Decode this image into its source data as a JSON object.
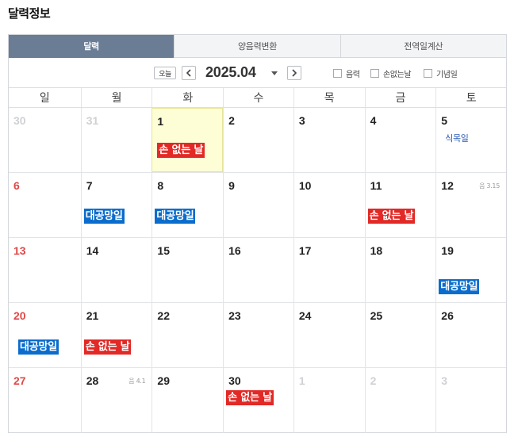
{
  "page": {
    "title": "달력정보"
  },
  "tabs": [
    {
      "label": "달력",
      "active": true
    },
    {
      "label": "양음력변환",
      "active": false
    },
    {
      "label": "전역일계산",
      "active": false
    }
  ],
  "controls": {
    "today_label": "오늘",
    "month_label": "2025.04",
    "options": [
      {
        "label": "음력",
        "checked": false
      },
      {
        "label": "손없는날",
        "checked": false
      },
      {
        "label": "기념일",
        "checked": false
      }
    ]
  },
  "weekdays": [
    "일",
    "월",
    "화",
    "수",
    "목",
    "금",
    "토"
  ],
  "weeks": [
    [
      {
        "day": "30",
        "other": true
      },
      {
        "day": "31",
        "other": true
      },
      {
        "day": "1",
        "today": true,
        "badge": {
          "text": "손 없는 날",
          "color": "red"
        }
      },
      {
        "day": "2"
      },
      {
        "day": "3"
      },
      {
        "day": "4"
      },
      {
        "day": "5",
        "holiday": "식목일"
      }
    ],
    [
      {
        "day": "6",
        "sunday": true
      },
      {
        "day": "7",
        "badge": {
          "text": "대공망일",
          "color": "blue"
        }
      },
      {
        "day": "8",
        "badge": {
          "text": "대공망일",
          "color": "blue"
        }
      },
      {
        "day": "9"
      },
      {
        "day": "10"
      },
      {
        "day": "11",
        "badge": {
          "text": "손 없는 날",
          "color": "red"
        }
      },
      {
        "day": "12",
        "lunar": "음 3.15"
      }
    ],
    [
      {
        "day": "13",
        "sunday": true
      },
      {
        "day": "14"
      },
      {
        "day": "15"
      },
      {
        "day": "16"
      },
      {
        "day": "17"
      },
      {
        "day": "18"
      },
      {
        "day": "19",
        "badge": {
          "text": "대공망일",
          "color": "blue"
        }
      }
    ],
    [
      {
        "day": "20",
        "sunday": true,
        "badge": {
          "text": "대공망일",
          "color": "blue"
        }
      },
      {
        "day": "21",
        "badge": {
          "text": "손 없는 날",
          "color": "red"
        }
      },
      {
        "day": "22"
      },
      {
        "day": "23"
      },
      {
        "day": "24"
      },
      {
        "day": "25"
      },
      {
        "day": "26"
      }
    ],
    [
      {
        "day": "27",
        "sunday": true
      },
      {
        "day": "28",
        "lunar": "음 4.1"
      },
      {
        "day": "29"
      },
      {
        "day": "30",
        "badge": {
          "text": "손 없는 날",
          "color": "red"
        }
      },
      {
        "day": "1",
        "other": true
      },
      {
        "day": "2",
        "other": true
      },
      {
        "day": "3",
        "other": true
      }
    ]
  ]
}
